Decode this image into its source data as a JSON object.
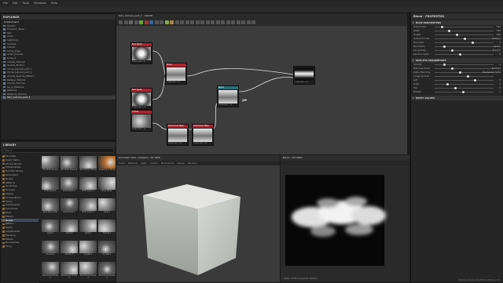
{
  "menu": [
    "File",
    "Edit",
    "Tools",
    "Windows",
    "Help"
  ],
  "graph": {
    "tab_title": "Tuto_tutorial_part_1 - GRAPH"
  },
  "explorer": {
    "title": "EXPLORER",
    "items": [
      {
        "label": "Untitled.sbs*",
        "root": true
      },
      {
        "label": "Header"
      },
      {
        "label": "Procedur_Base"
      },
      {
        "label": "Tarn"
      },
      {
        "label": "Lines"
      },
      {
        "label": "Lightning"
      },
      {
        "label": "Inmune"
      },
      {
        "label": "Cracks"
      },
      {
        "label": "Circle_base"
      },
      {
        "label": "Lines_tutorial"
      },
      {
        "label": "Lines_2"
      },
      {
        "label": "Clouds_Tutorial"
      },
      {
        "label": "Source_Borton"
      },
      {
        "label": "Circle_tutorial_part_1"
      },
      {
        "label": "Circle_tutorial_part_2"
      },
      {
        "label": "Clouds_Special_Pattern"
      },
      {
        "label": "Pattern_Tutorial"
      },
      {
        "label": "Cracks_Tutorial"
      },
      {
        "label": "Su_G_Patterns"
      },
      {
        "label": "Patterns"
      },
      {
        "label": "Patterns_Tutorial"
      },
      {
        "label": "Tuto_tutorial_part_1",
        "selected": true
      }
    ]
  },
  "library": {
    "title": "LIBRARY",
    "search_placeholder": "Search",
    "categories": [
      {
        "label": "Favorites"
      },
      {
        "label": "Graph Items"
      },
      {
        "label": "Atomic Nodes"
      },
      {
        "label": "FxMap Nodes"
      },
      {
        "label": "Function Nodes"
      },
      {
        "label": "Generators"
      },
      {
        "label": "Noises"
      },
      {
        "label": "Patterns"
      },
      {
        "label": "Scratches"
      },
      {
        "label": "Grunges"
      },
      {
        "label": "Legacy"
      },
      {
        "label": "Compositions"
      },
      {
        "label": "Filters"
      },
      {
        "label": "Adjustments"
      },
      {
        "label": "Procedural"
      },
      {
        "label": "Blurs"
      },
      {
        "label": "Effects"
      },
      {
        "label": "Noises",
        "selected": true
      },
      {
        "label": "Pattern"
      },
      {
        "label": "Filters"
      },
      {
        "label": "Adjustments"
      },
      {
        "label": "Blending"
      },
      {
        "label": "Effects"
      },
      {
        "label": "Normal Map"
      },
      {
        "label": "Tiling"
      }
    ],
    "thumbs": [
      {
        "label": "3D Perlin Noise",
        "tone": "#7a7a7a"
      },
      {
        "label": "3D Perlin Noise 2",
        "tone": "#6c6c6c"
      },
      {
        "label": "3D Simplex Noise",
        "tone": "#8a8a8a"
      },
      {
        "label": "Anisotropic Noise",
        "tone": "#b87030"
      },
      {
        "label": "BnW Spots 1",
        "tone": "#666"
      },
      {
        "label": "BnW Spots 2",
        "tone": "#777"
      },
      {
        "label": "BnW Spots 3",
        "tone": "#888"
      },
      {
        "label": "Blue Noise",
        "tone": "#999"
      },
      {
        "label": "Blue Noise Fast",
        "tone": "#707070"
      },
      {
        "label": "BnW Spots 1",
        "tone": "#606060"
      },
      {
        "label": "BnW Spots 2",
        "tone": "#808080"
      },
      {
        "label": "Cells 1",
        "tone": "#909090"
      },
      {
        "label": "Cells 2",
        "tone": "#6a6a6a"
      },
      {
        "label": "Cells 3",
        "tone": "#7e7e7e"
      },
      {
        "label": "Cells 4",
        "tone": "#8e8e8e"
      },
      {
        "label": "Clouds 1",
        "tone": "#9a9a9a"
      },
      {
        "label": "Clouds 2",
        "tone": "#6e6e6e"
      },
      {
        "label": "Clouds 3",
        "tone": "#7c7c7c"
      },
      {
        "label": "Crystal 1",
        "tone": "#8c8c8c"
      },
      {
        "label": "Crystal 2",
        "tone": "#5e5e5e"
      },
      {
        "label": "Directional Noise 1",
        "tone": "#737373"
      },
      {
        "label": "Directional Noise 2",
        "tone": "#838383"
      },
      {
        "label": "Directional Noise 3",
        "tone": "#939393"
      },
      {
        "label": "Directional Noise 4",
        "tone": "#636363"
      }
    ]
  },
  "nodes": [
    {
      "title": "Bnw Spots",
      "foot": "2048x2048 - L16",
      "color": "red"
    },
    {
      "title": "Blend",
      "foot": "2048x2048 - L16",
      "color": "red"
    },
    {
      "title": "Bnw Spots",
      "foot": "2048x2048 - L16",
      "color": "red"
    },
    {
      "title": "Blend",
      "foot": "2048x2048 - L16",
      "color": "teal"
    },
    {
      "title": "Clouds",
      "foot": "2048x2048 - L16",
      "color": "red"
    },
    {
      "title": "Directional Warp",
      "foot": "2048x2048 - L16",
      "color": "red"
    },
    {
      "title": "Directional Warp",
      "foot": "2048x2048 - L16",
      "color": "red"
    },
    {
      "title": "Output",
      "foot": "2048x2048 - L16",
      "color": "none"
    }
  ],
  "view3d": {
    "title": "Rounded Cube - Viewer3 - 3D VIEW",
    "menu": [
      "Scene",
      "Materials",
      "Lights",
      "Camera",
      "Environment",
      "Display",
      "Renderer"
    ]
  },
  "view2d": {
    "title": "Blend - 2D VIEW",
    "status": "2048 x 2048 (Grayscale, 16bpc)"
  },
  "props": {
    "title": "Blend - PROPERTIES",
    "sections": [
      {
        "name": "BASE PARAMETERS",
        "rows": [
          {
            "label": "Output Size",
            "value": "512"
          },
          {
            "label": "Width",
            "value": "512"
          },
          {
            "label": "Height",
            "value": "512"
          },
          {
            "label": "Output Format",
            "value": "Relative"
          },
          {
            "label": "Pixel Size",
            "value": "1"
          },
          {
            "label": "Pixel Ratio",
            "value": "Square"
          },
          {
            "label": "Tiling Mode",
            "value": "H and V"
          },
          {
            "label": "Random Seed",
            "value": "0"
          }
        ]
      },
      {
        "name": "SPECIFIC PARAMETERS",
        "rows": [
          {
            "label": "Opacity",
            "value": "1"
          },
          {
            "label": "Blending Mode",
            "value": "Subtract"
          },
          {
            "label": "Alpha Blending",
            "value": "Use Source Alpha"
          },
          {
            "label": "Cropping Area",
            "value": ""
          },
          {
            "label": "Left",
            "value": "0"
          },
          {
            "label": "Right",
            "value": "1"
          },
          {
            "label": "Top",
            "value": "0"
          },
          {
            "label": "Bottom",
            "value": "1"
          }
        ]
      },
      {
        "name": "INPUT VALUES",
        "rows": []
      }
    ]
  },
  "footer": {
    "status": "Substance Engine: Direct3D 11 Memory: 3%"
  }
}
